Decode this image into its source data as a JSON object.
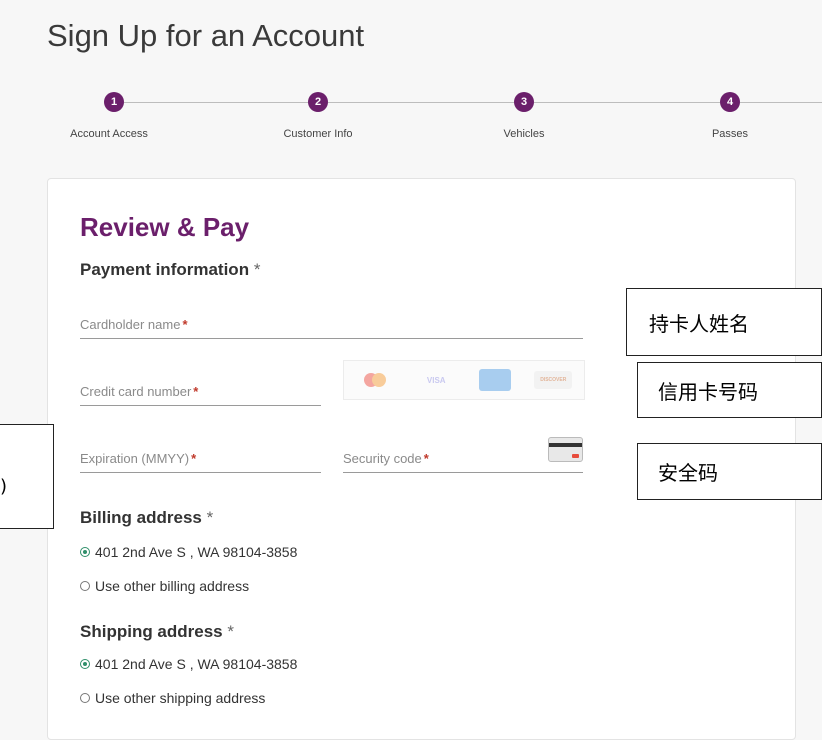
{
  "page": {
    "title": "Sign Up for an Account"
  },
  "stepper": {
    "steps": [
      {
        "num": "1",
        "label": "Account Access"
      },
      {
        "num": "2",
        "label": "Customer Info"
      },
      {
        "num": "3",
        "label": "Vehicles"
      },
      {
        "num": "4",
        "label": "Passes"
      }
    ]
  },
  "review": {
    "title": "Review & Pay",
    "payment_heading": "Payment information",
    "required_mark": "*",
    "fields": {
      "cardholder": "Cardholder name",
      "card_number": "Credit card number",
      "expiration": "Expiration (MMYY)",
      "security": "Security code"
    },
    "card_logos": {
      "visa": "VISA",
      "discover": "DISCOVER"
    },
    "billing": {
      "heading": "Billing address",
      "option_saved": "401 2nd Ave S , WA 98104-3858",
      "option_other": "Use other billing address"
    },
    "shipping": {
      "heading": "Shipping address",
      "option_saved": "401 2nd Ave S , WA 98104-3858",
      "option_other": "Use other shipping address"
    }
  },
  "annotations": {
    "cardholder": "持卡人姓名",
    "card_number": "信用卡号码",
    "security": "安全码",
    "left_partial": ")"
  },
  "colors": {
    "accent": "#6b1f6b",
    "radio_selected": "#2f8f6a"
  }
}
